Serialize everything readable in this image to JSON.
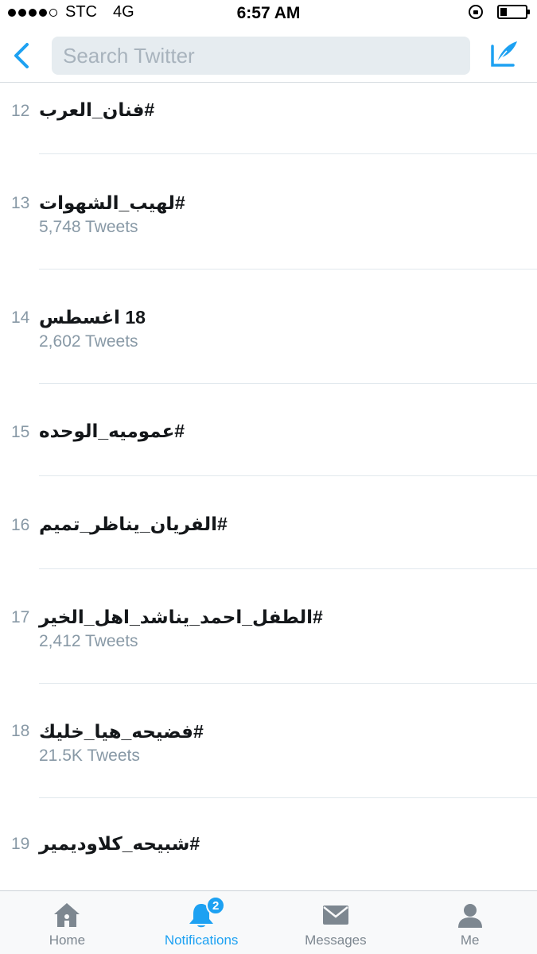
{
  "status_bar": {
    "carrier": "STC",
    "network": "4G",
    "time": "6:57 AM",
    "signal_bars": 4,
    "battery_level": 0.25
  },
  "nav": {
    "search_placeholder": "Search Twitter",
    "back_icon": "chevron-left-icon",
    "compose_icon": "compose-icon"
  },
  "trends": [
    {
      "rank": "12",
      "name": "#فنان_العرب",
      "count": ""
    },
    {
      "rank": "13",
      "name": "#لهيب_الشهوات",
      "count": "5,748 Tweets"
    },
    {
      "rank": "14",
      "name": "18 اغسطس",
      "count": "2,602 Tweets"
    },
    {
      "rank": "15",
      "name": "#عموميه_الوحده",
      "count": ""
    },
    {
      "rank": "16",
      "name": "#الفريان_يناظر_تميم",
      "count": ""
    },
    {
      "rank": "17",
      "name": "#الطفل_احمد_يناشد_اهل_الخير",
      "count": "2,412 Tweets"
    },
    {
      "rank": "18",
      "name": "#فضيحه_هيا_خليك",
      "count": "21.5K Tweets"
    },
    {
      "rank": "19",
      "name": "#شبيحه_كلاوديمير",
      "count": ""
    }
  ],
  "tabs": [
    {
      "label": "Home",
      "icon": "home-icon",
      "active": false
    },
    {
      "label": "Notifications",
      "icon": "bell-icon",
      "active": true,
      "badge": "2"
    },
    {
      "label": "Messages",
      "icon": "envelope-icon",
      "active": false
    },
    {
      "label": "Me",
      "icon": "person-icon",
      "active": false
    }
  ],
  "colors": {
    "accent": "#1da1f2",
    "secondary_text": "#8899a6",
    "tab_inactive": "#7d8790"
  }
}
